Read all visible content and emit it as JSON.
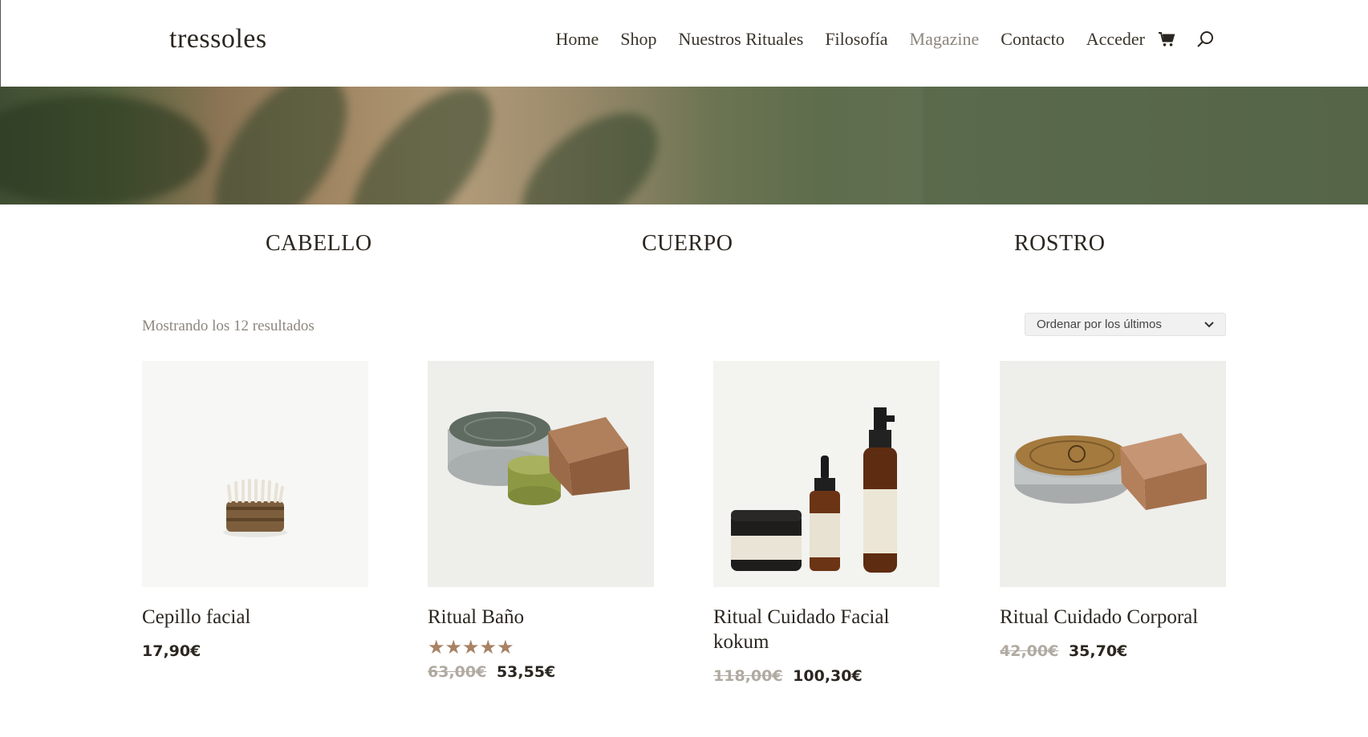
{
  "header": {
    "logo": "tressoles",
    "nav": [
      {
        "label": "Home",
        "muted": false
      },
      {
        "label": "Shop",
        "muted": false
      },
      {
        "label": "Nuestros Rituales",
        "muted": false
      },
      {
        "label": "Filosofía",
        "muted": false
      },
      {
        "label": "Magazine",
        "muted": true
      },
      {
        "label": "Contacto",
        "muted": false
      },
      {
        "label": "Acceder",
        "muted": false
      }
    ],
    "cart_icon": "cart-icon",
    "search_icon": "search-icon"
  },
  "categories": [
    "CABELLO",
    "CUERPO",
    "ROSTRO"
  ],
  "toolbar": {
    "result_count": "Mostrando los 12 resultados",
    "orderby_selected": "Ordenar por los últimos"
  },
  "products": [
    {
      "title": "Cepillo facial",
      "price": "17,90€",
      "old_price": "",
      "rating": 0
    },
    {
      "title": "Ritual Baño",
      "price": "53,55€",
      "old_price": "63,00€",
      "rating": 5
    },
    {
      "title": "Ritual Cuidado Facial kokum",
      "price": "100,30€",
      "old_price": "118,00€",
      "rating": 0
    },
    {
      "title": "Ritual Cuidado Corporal",
      "price": "35,70€",
      "old_price": "42,00€",
      "rating": 0
    }
  ],
  "colors": {
    "accent": "#a88264",
    "text": "#2b2620",
    "muted": "#8b857c"
  }
}
